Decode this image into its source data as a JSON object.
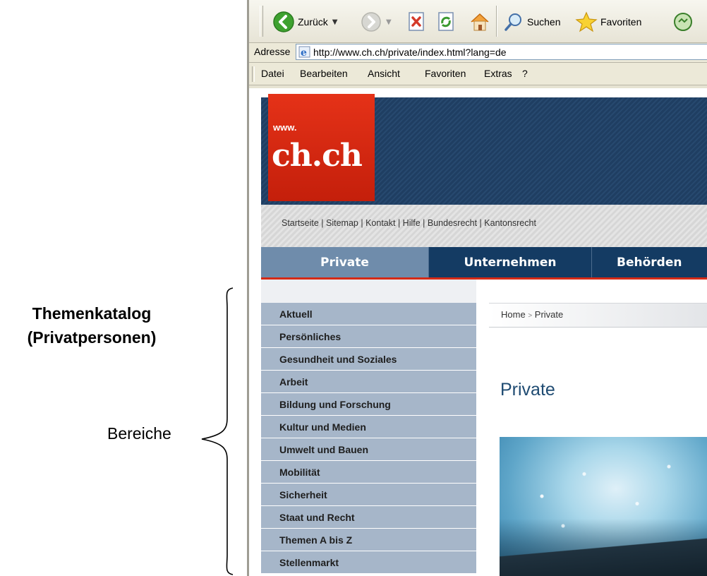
{
  "annotation": {
    "title_line1": "Themenkatalog",
    "title_line2": "(Privatpersonen)",
    "brace_label": "Bereiche"
  },
  "browser": {
    "toolbar": {
      "back_label": "Zurück",
      "search_label": "Suchen",
      "favorites_label": "Favoriten"
    },
    "address_bar": {
      "label": "Adresse",
      "url": "http://www.ch.ch/private/index.html?lang=de"
    },
    "menu": [
      "Datei",
      "Bearbeiten",
      "Ansicht",
      "Favoriten",
      "Extras",
      "?"
    ]
  },
  "site": {
    "logo_prefix": "www.",
    "logo_text": "ch.ch",
    "service_links": [
      "Startseite",
      "Sitemap",
      "Kontakt",
      "Hilfe",
      "Bundesrecht",
      "Kantonsrecht"
    ],
    "tabs": [
      "Private",
      "Unternehmen",
      "Behörden"
    ],
    "active_tab": "Private",
    "sidenav": [
      "Aktuell",
      "Persönliches",
      "Gesundheit und Soziales",
      "Arbeit",
      "Bildung und Forschung",
      "Kultur und Medien",
      "Umwelt und Bauen",
      "Mobilität",
      "Sicherheit",
      "Staat und Recht",
      "Themen A bis Z",
      "Stellenmarkt"
    ],
    "breadcrumb": {
      "home": "Home",
      "separator": ">",
      "current": "Private"
    },
    "page_title": "Private",
    "colors": {
      "brand_red": "#d52a16",
      "header_blue": "#1f3e62",
      "nav_item_bg": "#a6b6c9",
      "heading_blue": "#1f4b72"
    }
  }
}
